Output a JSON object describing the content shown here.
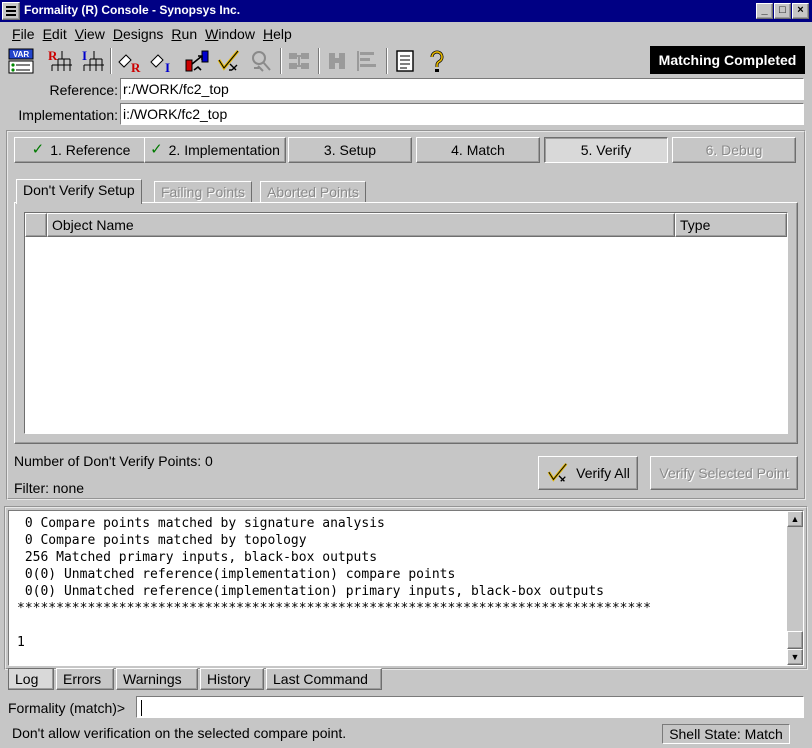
{
  "window": {
    "title": "Formality (R) Console - Synopsys Inc.",
    "minimize_glyph": "_",
    "maximize_glyph": "□",
    "close_glyph": "×"
  },
  "menu": [
    {
      "label": "File",
      "accel": "F",
      "rest": "ile"
    },
    {
      "label": "Edit",
      "accel": "E",
      "rest": "dit"
    },
    {
      "label": "View",
      "accel": "V",
      "rest": "iew"
    },
    {
      "label": "Designs",
      "accel": "D",
      "rest": "esigns"
    },
    {
      "label": "Run",
      "accel": "R",
      "rest": "un"
    },
    {
      "label": "Window",
      "accel": "W",
      "rest": "indow"
    },
    {
      "label": "Help",
      "accel": "H",
      "rest": "elp"
    }
  ],
  "toolbar": {
    "var_icon_text": "VAR",
    "ref_letter": "R",
    "impl_letter": "I"
  },
  "status_banner": "Matching Completed",
  "designs": {
    "reference_label": "Reference:",
    "reference_value": "r:/WORK/fc2_top",
    "implementation_label": "Implementation:",
    "implementation_value": "i:/WORK/fc2_top"
  },
  "steps": [
    {
      "label": "1. Reference",
      "checked": true
    },
    {
      "label": "2. Implementation",
      "checked": true
    },
    {
      "label": "3. Setup"
    },
    {
      "label": "4. Match"
    },
    {
      "label": "5. Verify",
      "active": true
    },
    {
      "label": "6. Debug",
      "disabled": true
    }
  ],
  "check_glyph": "✓",
  "tabs": [
    {
      "label": "Don't Verify Setup",
      "active": true
    },
    {
      "label": "Failing Points",
      "disabled": true
    },
    {
      "label": "Aborted Points",
      "disabled": true
    }
  ],
  "table": {
    "columns": [
      "Object Name",
      "Type"
    ]
  },
  "summary": {
    "count_label": "Number of Don't Verify Points:",
    "count_value": "0",
    "filter_label": "Filter:",
    "filter_value": "none"
  },
  "buttons": {
    "verify_all": "Verify All",
    "verify_selected": "Verify Selected Point"
  },
  "log": {
    "lines": [
      " 0 Compare points matched by signature analysis",
      " 0 Compare points matched by topology",
      " 256 Matched primary inputs, black-box outputs",
      " 0(0) Unmatched reference(implementation) compare points",
      " 0(0) Unmatched reference(implementation) primary inputs, black-box outputs",
      "*********************************************************************************",
      "",
      "1"
    ],
    "up_arrow": "▲",
    "down_arrow": "▼"
  },
  "bottom_tabs": [
    {
      "label": "Log",
      "active": true
    },
    {
      "label": "Errors"
    },
    {
      "label": "Warnings"
    },
    {
      "label": "History"
    },
    {
      "label": "Last Command"
    }
  ],
  "prompt": {
    "label": "Formality (match)>",
    "value": ""
  },
  "statusbar": {
    "message": "Don't allow verification on the selected compare point.",
    "shell_state": "Shell State: Match"
  }
}
